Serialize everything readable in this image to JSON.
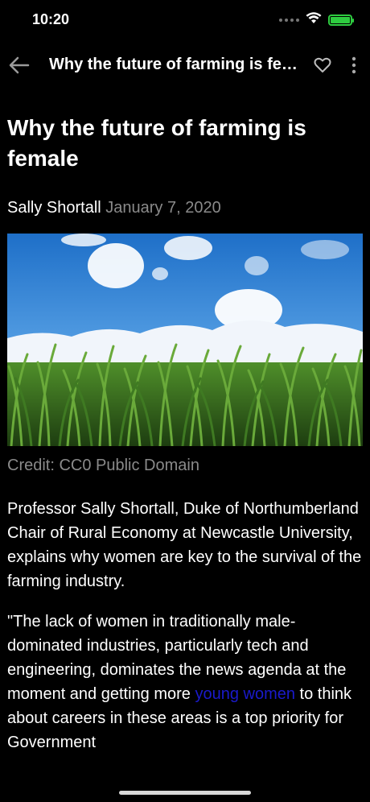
{
  "status": {
    "time": "10:20"
  },
  "app_bar": {
    "title": "Why the future of farming is female"
  },
  "article": {
    "title": "Why the future of farming is female",
    "author": "Sally Shortall",
    "date": "January 7, 2020",
    "credit": "Credit: CC0 Public Domain",
    "para1": "Professor Sally Shortall, Duke of Northumberland Chair of Rural Economy at Newcastle University, explains why women are key to the survival of the farming industry.",
    "para2_before_link": "\"The lack of women in traditionally male-dominated industries, particularly tech and engineering, dominates the news agenda at the moment and getting more ",
    "para2_link": "young women",
    "para2_after_link": " to think about careers in these areas is a top priority for Government"
  },
  "icons": {
    "back": "back-arrow-icon",
    "heart": "heart-icon",
    "more": "more-vertical-icon",
    "wifi": "wifi-icon",
    "battery": "battery-charging-icon"
  },
  "colors": {
    "background": "#000000",
    "link": "#1a1acc",
    "muted": "#8a8a8a",
    "battery": "#2ecc40"
  }
}
